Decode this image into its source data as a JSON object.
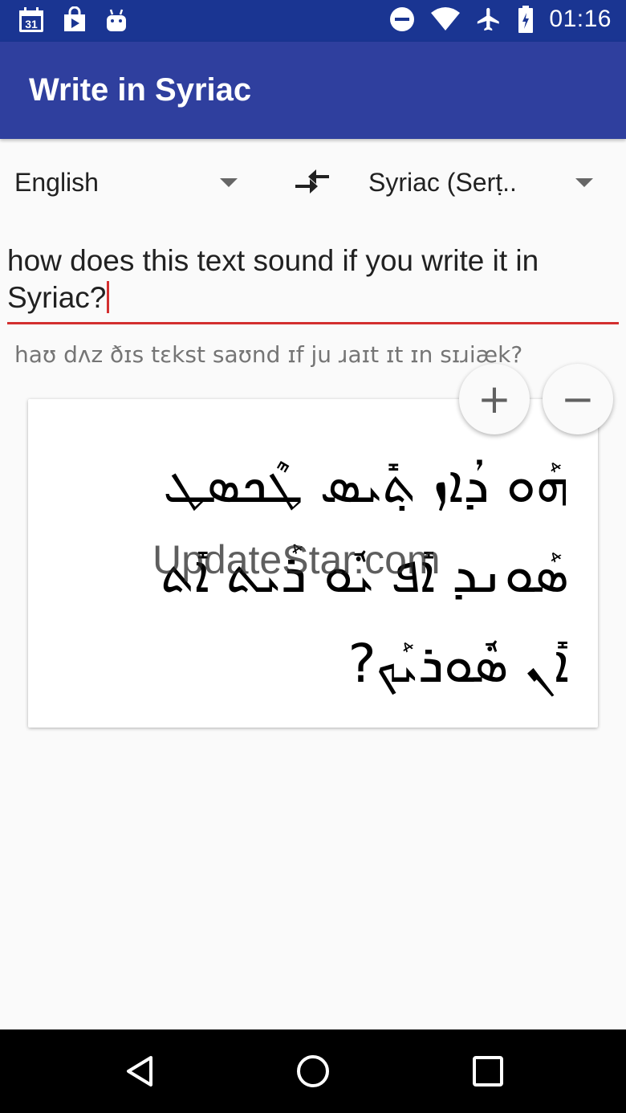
{
  "status_bar": {
    "time": "01:16",
    "calendar_day": "31",
    "icons_left": [
      "calendar-icon",
      "play-store-icon",
      "android-icon"
    ],
    "icons_right": [
      "do-not-disturb-icon",
      "wifi-icon",
      "airplane-icon",
      "battery-icon"
    ]
  },
  "app_bar": {
    "title": "Write in Syriac"
  },
  "languages": {
    "source": "English",
    "target": "Syriac (Serṭ..",
    "swap_icon": "swap-arrows-icon"
  },
  "input": {
    "value": "how does this text sound if you write it in Syriac?"
  },
  "phonetic": "haʊ dʌz ðɪs tɛkst saʊnd ɪf ju ɹaɪt ɪt ɪn sɪɹiæk?",
  "output": {
    "syriac_text": "ܗܰܘ ܕܳܐܙ ܬ݂ܺܝܣ ܛܶܟܣܛ ܣܰܘܢܕ ܐܺܦ ܝܽܘ ܪܰܝܬ ܐܺܬ ܐܺܢ ܣܽܘܪܝܰܟ?",
    "watermark": "UpdateStar.com"
  },
  "zoom": {
    "plus_label": "+",
    "minus_label": "−"
  },
  "colors": {
    "status_bar": "#1a3592",
    "app_bar": "#2f3f9e",
    "accent": "#d32f2f"
  },
  "nav_bar": {
    "icons": [
      "back-icon",
      "home-icon",
      "recents-icon"
    ]
  }
}
